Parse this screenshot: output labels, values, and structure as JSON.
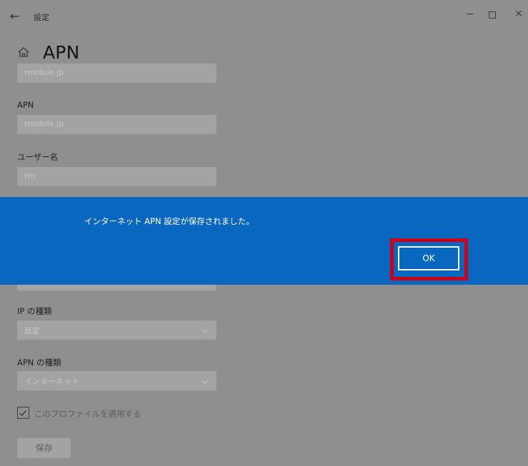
{
  "window": {
    "title": "設定",
    "min_glyph": "−",
    "close_glyph": "×"
  },
  "page": {
    "title": "APN"
  },
  "fields": {
    "profile_name_value": "rmobile.jp",
    "apn_label": "APN",
    "apn_value": "rmobile.jp",
    "username_label": "ユーザー名",
    "username_value": "rm",
    "ip_type_label": "IP の種類",
    "ip_type_value": "既定",
    "apn_type_label": "APN の種類",
    "apn_type_value": "インターネット"
  },
  "dialog": {
    "message": "インターネット APN 設定が保存されました。",
    "ok_label": "OK"
  },
  "apply_profile": {
    "label": "このプロファイルを適用する",
    "checked": true
  },
  "save_label": "保存",
  "colors": {
    "dialog_bg": "#0a67bf",
    "highlight": "#cc0018",
    "overlay": "#8f8f8f"
  },
  "icons": {
    "back": "arrow-left-icon",
    "home": "home-icon",
    "dropdown": "chevron-down-icon",
    "check": "checkmark-icon"
  }
}
